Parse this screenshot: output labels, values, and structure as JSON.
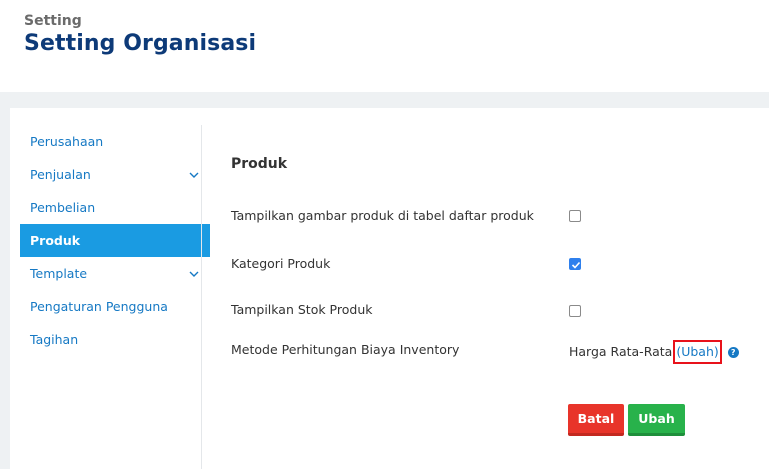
{
  "header": {
    "breadcrumb": "Setting",
    "title": "Setting Organisasi"
  },
  "sidebar": {
    "items": [
      {
        "label": "Perusahaan",
        "has_chevron": false,
        "active": false
      },
      {
        "label": "Penjualan",
        "has_chevron": true,
        "active": false
      },
      {
        "label": "Pembelian",
        "has_chevron": false,
        "active": false
      },
      {
        "label": "Produk",
        "has_chevron": false,
        "active": true
      },
      {
        "label": "Template",
        "has_chevron": true,
        "active": false
      },
      {
        "label": "Pengaturan Pengguna",
        "has_chevron": false,
        "active": false
      },
      {
        "label": "Tagihan",
        "has_chevron": false,
        "active": false
      }
    ]
  },
  "content": {
    "section_title": "Produk",
    "settings": [
      {
        "label": "Tampilkan gambar produk di tabel daftar produk",
        "checked": false
      },
      {
        "label": "Kategori Produk",
        "checked": true
      },
      {
        "label": "Tampilkan Stok Produk",
        "checked": false
      }
    ],
    "inventory_method": {
      "label": "Metode Perhitungan Biaya Inventory",
      "value": "Harga Rata-Rata",
      "change_link": "(Ubah)",
      "help_icon": "question-circle-icon"
    },
    "buttons": {
      "cancel": "Batal",
      "save": "Ubah"
    }
  },
  "colors": {
    "title": "#0d3a78",
    "link": "#1679c4",
    "active_item_bg": "#1a9be2",
    "checkbox_checked": "#2f80ed",
    "cancel_button": "#e8342a",
    "save_button": "#28b24b",
    "highlight_box": "#e8121b"
  }
}
